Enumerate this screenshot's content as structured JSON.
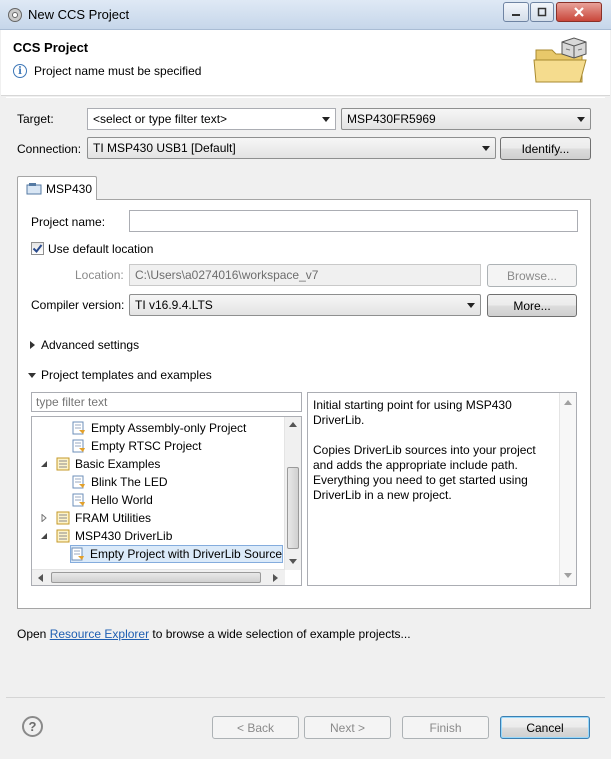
{
  "window": {
    "title": "New CCS Project"
  },
  "header": {
    "title": "CCS Project",
    "message": "Project name must be specified"
  },
  "target": {
    "label": "Target:",
    "filter_value": "<select or type filter text>",
    "device_value": "MSP430FR5969"
  },
  "connection": {
    "label": "Connection:",
    "value": "TI MSP430 USB1 [Default]",
    "identify_label": "Identify..."
  },
  "tab": {
    "label": "MSP430"
  },
  "project_name": {
    "label": "Project name:",
    "value": ""
  },
  "use_default_location": {
    "label": "Use default location",
    "checked": true
  },
  "location": {
    "label": "Location:",
    "value": "C:\\Users\\a0274016\\workspace_v7",
    "browse_label": "Browse..."
  },
  "compiler": {
    "label": "Compiler version:",
    "value": "TI v16.9.4.LTS",
    "more_label": "More..."
  },
  "sections": {
    "advanced": "Advanced settings",
    "templates": "Project templates and examples"
  },
  "templates": {
    "filter_placeholder": "type filter text",
    "tree": [
      {
        "label": "Empty Assembly-only Project",
        "level": 2,
        "kind": "template"
      },
      {
        "label": "Empty RTSC Project",
        "level": 2,
        "kind": "template"
      },
      {
        "label": "Basic Examples",
        "level": 1,
        "kind": "folder",
        "state": "expanded"
      },
      {
        "label": "Blink The LED",
        "level": 2,
        "kind": "template"
      },
      {
        "label": "Hello World",
        "level": 2,
        "kind": "template"
      },
      {
        "label": "FRAM Utilities",
        "level": 1,
        "kind": "folder",
        "state": "collapsed"
      },
      {
        "label": "MSP430 DriverLib",
        "level": 1,
        "kind": "folder",
        "state": "expanded"
      },
      {
        "label": "Empty Project with DriverLib Source",
        "level": 2,
        "kind": "template",
        "selected": true
      }
    ],
    "description": [
      "Initial starting point for using MSP430 DriverLib.",
      "Copies DriverLib sources into your project and adds the appropriate include path. Everything you need to get started using DriverLib in a new project."
    ]
  },
  "resource_line": {
    "prefix": "Open ",
    "link": "Resource Explorer",
    "suffix": " to browse a wide selection of example projects..."
  },
  "buttons": {
    "back": "< Back",
    "next": "Next >",
    "finish": "Finish",
    "cancel": "Cancel"
  }
}
